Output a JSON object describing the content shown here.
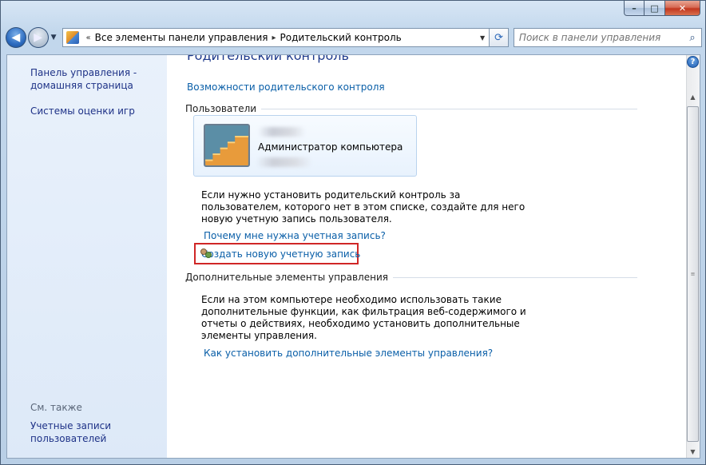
{
  "window": {
    "minimize": "–",
    "maximize": "□",
    "close": "✕"
  },
  "address_bar": {
    "prefix": "«",
    "crumbs": [
      "Все элементы панели управления",
      "Родительский контроль"
    ],
    "separator": "▸",
    "dropdown": "▼",
    "refresh": "⟳"
  },
  "search": {
    "placeholder": "Поиск в панели управления",
    "icon": "⌕"
  },
  "left_pane": {
    "home_link_line1": "Панель управления -",
    "home_link_line2": "домашняя страница",
    "game_ratings": "Системы оценки игр",
    "see_also": "См. также",
    "user_accounts_line1": "Учетные записи",
    "user_accounts_line2": "пользователей"
  },
  "main": {
    "title": "Родительский контроль",
    "features_link": "Возможности родительского контроля",
    "users_heading": "Пользователи",
    "user": {
      "role": "Администратор компьютера"
    },
    "info_text_1": "Если нужно установить родительский контроль за пользователем, которого нет в этом списке, создайте для него новую учетную запись пользователя.",
    "why_link": "Почему мне нужна учетная запись?",
    "create_link": "Создать новую учетную запись",
    "additional_heading": "Дополнительные элементы управления",
    "info_text_2": "Если на этом компьютере необходимо использовать такие дополнительные функции, как фильтрация веб-содержимого и отчеты о действиях, необходимо установить дополнительные элементы управления.",
    "install_link": "Как установить дополнительные элементы управления?"
  },
  "scrollbar": {
    "help": "?",
    "up": "▲",
    "down": "▼",
    "grip": "≡"
  }
}
